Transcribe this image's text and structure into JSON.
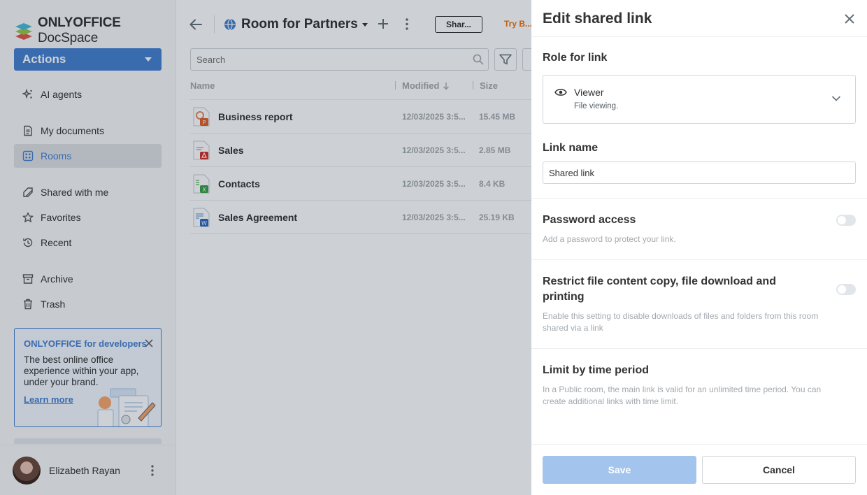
{
  "app": {
    "logo_brand": "ONLYOFFICE",
    "logo_product": "DocSpace",
    "accent_color": "#4781d1"
  },
  "sidebar": {
    "actions_label": "Actions",
    "items": [
      {
        "label": "AI agents",
        "icon": "ai-sparkle-icon"
      },
      {
        "label": "My documents",
        "icon": "document-icon"
      },
      {
        "label": "Rooms",
        "icon": "rooms-grid-icon",
        "active": true
      },
      {
        "label": "Shared with me",
        "icon": "shared-icon"
      },
      {
        "label": "Favorites",
        "icon": "star-icon"
      },
      {
        "label": "Recent",
        "icon": "clock-icon"
      },
      {
        "label": "Archive",
        "icon": "archive-icon"
      },
      {
        "label": "Trash",
        "icon": "trash-icon"
      }
    ],
    "dev_card": {
      "title": "ONLYOFFICE for developers",
      "text": "The best online office experience within your app, under your brand.",
      "link": "Learn more"
    },
    "user": {
      "name": "Elizabeth Rayan"
    }
  },
  "main": {
    "room_title": "Room for Partners",
    "share_label": "Shar...",
    "try_label": "Try B...",
    "search_placeholder": "Search",
    "columns": {
      "name": "Name",
      "modified": "Modified",
      "size": "Size"
    },
    "files": [
      {
        "name": "Business report",
        "modified": "12/03/2025 3:5...",
        "size": "15.45 MB",
        "type": "presentation"
      },
      {
        "name": "Sales",
        "modified": "12/03/2025 3:5...",
        "size": "2.85 MB",
        "type": "pdf"
      },
      {
        "name": "Contacts",
        "modified": "12/03/2025 3:5...",
        "size": "8.4 KB",
        "type": "spreadsheet"
      },
      {
        "name": "Sales Agreement",
        "modified": "12/03/2025 3:5...",
        "size": "25.19 KB",
        "type": "document"
      }
    ]
  },
  "panel": {
    "title": "Edit shared link",
    "role_label": "Role for link",
    "role_title": "Viewer",
    "role_desc": "File viewing.",
    "link_name_label": "Link name",
    "link_name_value": "Shared link",
    "password_label": "Password access",
    "password_desc": "Add a password to protect your link.",
    "password_enabled": false,
    "restrict_label": "Restrict file content copy, file download and printing",
    "restrict_desc": "Enable this setting to disable downloads of files and folders from this room shared via a link",
    "restrict_enabled": false,
    "limit_label": "Limit by time period",
    "limit_desc": "In a Public room, the main link is valid for an unlimited time period. You can create additional links with time limit.",
    "save_label": "Save",
    "cancel_label": "Cancel"
  }
}
